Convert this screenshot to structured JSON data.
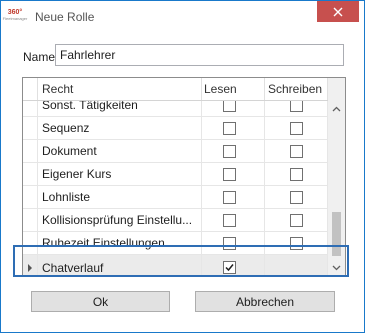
{
  "window": {
    "title": "Neue Rolle",
    "logo_text_top": "360°",
    "logo_text_bottom": "Fleetmanager"
  },
  "form": {
    "name_label": "Name",
    "name_value": "Fahrlehrer"
  },
  "grid": {
    "columns": {
      "recht": "Recht",
      "lesen": "Lesen",
      "schreiben": "Schreiben"
    },
    "rows": [
      {
        "recht": "Sonst. Tätigkeiten",
        "lesen": false,
        "schreiben": false
      },
      {
        "recht": "Sequenz",
        "lesen": false,
        "schreiben": false
      },
      {
        "recht": "Dokument",
        "lesen": false,
        "schreiben": false
      },
      {
        "recht": "Eigener Kurs",
        "lesen": false,
        "schreiben": false
      },
      {
        "recht": "Lohnliste",
        "lesen": false,
        "schreiben": false
      },
      {
        "recht": "Kollisionsprüfung Einstellu...",
        "lesen": false,
        "schreiben": false
      },
      {
        "recht": "Ruhezeit Einstellungen",
        "lesen": false,
        "schreiben": false
      },
      {
        "recht": "Chatverlauf",
        "lesen": true,
        "schreiben": null,
        "selected": true
      }
    ]
  },
  "buttons": {
    "ok": "Ok",
    "cancel": "Abbrechen"
  },
  "colors": {
    "close_button": "#c7504e",
    "window_border": "#1979ca",
    "highlight_border": "#2e6db4",
    "selected_row": "#ebebeb"
  }
}
